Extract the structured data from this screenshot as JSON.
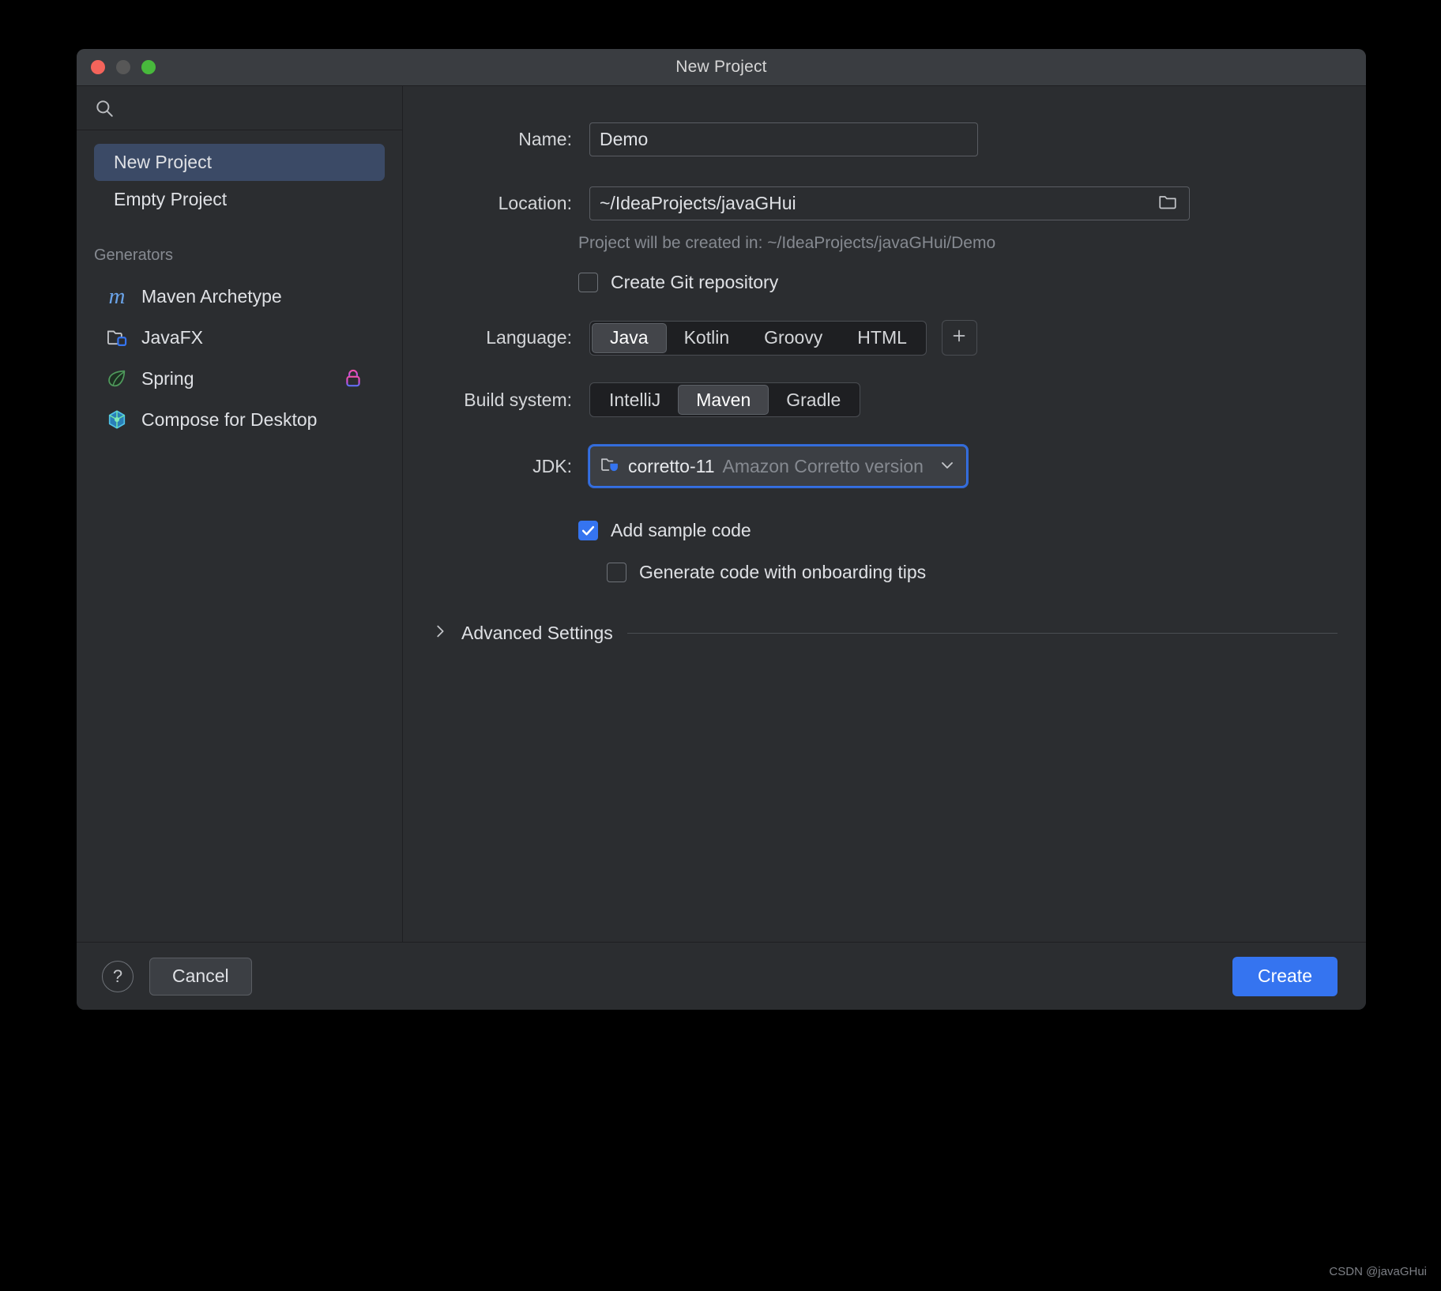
{
  "window": {
    "title": "New Project",
    "traffic_lights": [
      "close",
      "minimize",
      "maximize"
    ]
  },
  "sidebar": {
    "search_placeholder": "",
    "templates": [
      {
        "label": "New Project",
        "selected": true
      },
      {
        "label": "Empty Project",
        "selected": false
      }
    ],
    "generators_title": "Generators",
    "generators": [
      {
        "label": "Maven Archetype",
        "icon": "maven-icon",
        "locked": false
      },
      {
        "label": "JavaFX",
        "icon": "javafx-folder-icon",
        "locked": false
      },
      {
        "label": "Spring",
        "icon": "spring-leaf-icon",
        "locked": true
      },
      {
        "label": "Compose for Desktop",
        "icon": "compose-icon",
        "locked": false
      }
    ]
  },
  "form": {
    "name_label": "Name:",
    "name_value": "Demo",
    "location_label": "Location:",
    "location_value": "~/IdeaProjects/javaGHui",
    "location_hint": "Project will be created in: ~/IdeaProjects/javaGHui/Demo",
    "git_checkbox_label": "Create Git repository",
    "git_checked": false,
    "language_label": "Language:",
    "language_options": [
      "Java",
      "Kotlin",
      "Groovy",
      "HTML"
    ],
    "language_selected": "Java",
    "language_add_label": "+",
    "build_label": "Build system:",
    "build_options": [
      "IntelliJ",
      "Maven",
      "Gradle"
    ],
    "build_selected": "Maven",
    "jdk_label": "JDK:",
    "jdk_value": "corretto-11",
    "jdk_description": "Amazon Corretto version",
    "sample_code_label": "Add sample code",
    "sample_code_checked": true,
    "onboarding_label": "Generate code with onboarding tips",
    "onboarding_checked": false,
    "advanced_label": "Advanced Settings"
  },
  "footer": {
    "help_label": "?",
    "cancel_label": "Cancel",
    "create_label": "Create"
  },
  "watermark": "CSDN @javaGHui",
  "colors": {
    "accent": "#3574f0",
    "window_bg": "#2b2d30",
    "titlebar_bg": "#3a3d41",
    "selected_row": "#3b4a66",
    "close": "#f4645b",
    "minimize": "#575757",
    "maximize": "#48b93c",
    "lock": "#e24fa0"
  }
}
